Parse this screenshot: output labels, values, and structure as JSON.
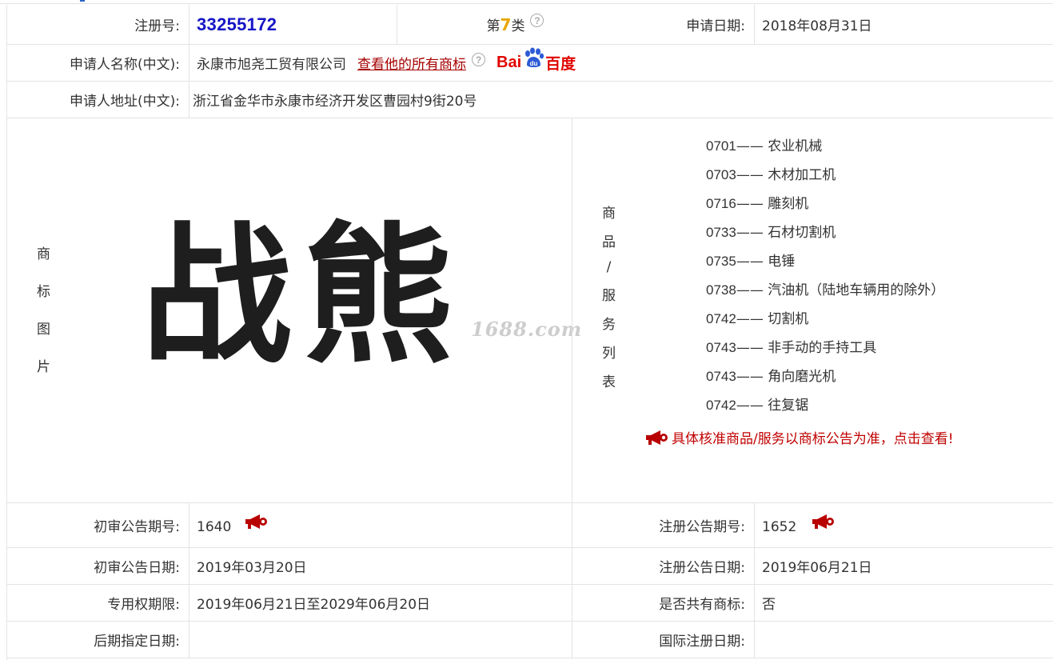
{
  "row1": {
    "reg_no_label": "注册号:",
    "reg_no": "33255172",
    "class_prefix": "第",
    "class_num": "7",
    "class_suffix": "类",
    "apply_date_label": "申请日期:",
    "apply_date": "2018年08月31日"
  },
  "applicant": {
    "name_label": "申请人名称(中文):",
    "name": "永康市旭尧工贸有限公司",
    "all_marks_link": "查看他的所有商标",
    "baidu_latin": "Bai",
    "baidu_zh": "百度",
    "address_label": "申请人地址(中文):",
    "address": "浙江省金华市永康市经济开发区曹园村9街20号"
  },
  "mark": {
    "side_label": [
      "商",
      "标",
      "图",
      "片"
    ],
    "text": "战熊",
    "watermark": "1688.com"
  },
  "goods": {
    "side_label": [
      "商",
      "品",
      "/",
      "服",
      "务",
      "列",
      "表"
    ],
    "items": [
      {
        "code": "0701",
        "name": "农业机械"
      },
      {
        "code": "0703",
        "name": "木材加工机"
      },
      {
        "code": "0716",
        "name": "雕刻机"
      },
      {
        "code": "0733",
        "name": "石材切割机"
      },
      {
        "code": "0735",
        "name": "电锤"
      },
      {
        "code": "0738",
        "name": "汽油机（陆地车辆用的除外）"
      },
      {
        "code": "0742",
        "name": "切割机"
      },
      {
        "code": "0743",
        "name": "非手动的手持工具"
      },
      {
        "code": "0743",
        "name": "角向磨光机"
      },
      {
        "code": "0742",
        "name": "往复锯"
      }
    ],
    "separator": "——",
    "notice": "具体核准商品/服务以商标公告为准，点击查看!"
  },
  "announce": {
    "prelim_no_label": "初审公告期号:",
    "prelim_no": "1640",
    "reg_no_label": "注册公告期号:",
    "reg_no": "1652",
    "prelim_date_label": "初审公告日期:",
    "prelim_date": "2019年03月20日",
    "reg_date_label": "注册公告日期:",
    "reg_date": "2019年06月21日",
    "exclusive_label": "专用权期限:",
    "exclusive": "2019年06月21日至2029年06月20日",
    "shared_label": "是否共有商标:",
    "shared": "否",
    "later_label": "后期指定日期:",
    "later": "",
    "intl_label": "国际注册日期:",
    "intl": ""
  },
  "colors": {
    "reg_no": "#1515c7",
    "class_num": "#e8a600",
    "link_red": "#a60000",
    "notice_red": "#c00000",
    "border": "#e3e3e3"
  },
  "icons": {
    "help": "question-circle-icon",
    "horn": "megaphone-icon",
    "baidu": "baidu-logo"
  }
}
